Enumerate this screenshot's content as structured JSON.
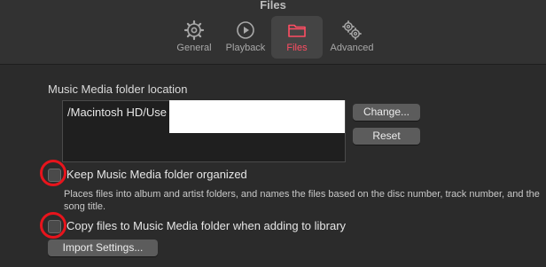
{
  "window": {
    "title": "Files"
  },
  "tabs": [
    {
      "label": "General",
      "icon": "gear-icon"
    },
    {
      "label": "Playback",
      "icon": "play-circle-icon"
    },
    {
      "label": "Files",
      "icon": "folder-icon",
      "selected": true
    },
    {
      "label": "Advanced",
      "icon": "gears-icon"
    }
  ],
  "media_folder": {
    "label": "Music Media folder location",
    "path": "/Macintosh HD/Use",
    "change_button": "Change...",
    "reset_button": "Reset"
  },
  "options": {
    "keep_organized": {
      "label": "Keep Music Media folder organized",
      "checked": false,
      "description": "Places files into album and artist folders, and names the files based on the disc number, track number, and the song title."
    },
    "copy_files": {
      "label": "Copy files to Music Media folder when adding to library",
      "checked": false
    }
  },
  "import_button": "Import Settings...",
  "colors": {
    "accent": "#ff4d63",
    "highlight_ring": "#e8141c",
    "background": "#2b2b2b"
  }
}
